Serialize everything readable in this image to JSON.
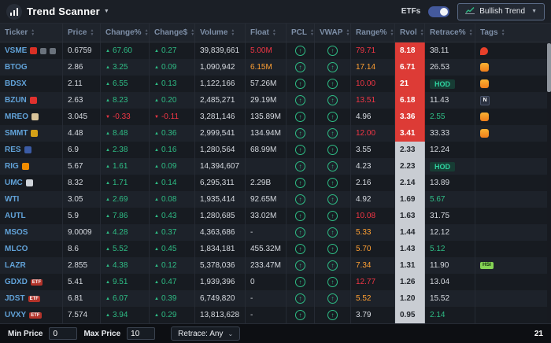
{
  "header": {
    "title": "Trend Scanner",
    "etfs_label": "ETFs",
    "etfs_toggle_on": true,
    "trend_label": "Bullish Trend"
  },
  "table": {
    "etf_badge_label": "ETF",
    "columns": [
      {
        "key": "ticker",
        "label": "Ticker"
      },
      {
        "key": "price",
        "label": "Price"
      },
      {
        "key": "chg_pct",
        "label": "Change%"
      },
      {
        "key": "chg_usd",
        "label": "Change$"
      },
      {
        "key": "volume",
        "label": "Volume"
      },
      {
        "key": "float",
        "label": "Float"
      },
      {
        "key": "pcl",
        "label": "PCL"
      },
      {
        "key": "vwap",
        "label": "VWAP"
      },
      {
        "key": "range",
        "label": "Range%"
      },
      {
        "key": "rvol",
        "label": "Rvol"
      },
      {
        "key": "retrace",
        "label": "Retrace%"
      },
      {
        "key": "tags",
        "label": "Tags"
      }
    ],
    "rows": [
      {
        "ticker": "VSME",
        "logo": "#d93025",
        "ticker_icons": [
          "megaphone-icon",
          "speaker-icon"
        ],
        "price": "0.6759",
        "chg_pct": "67.60",
        "chg_usd": "0.27",
        "dir": "up",
        "volume": "39,839,661",
        "float": "5.00M",
        "float_c": "red",
        "pcl": true,
        "vwap": true,
        "range": "79.71",
        "range_c": "red",
        "rvol": "8.18",
        "rvol_hot": true,
        "retrace": "38.11",
        "retrace_c": "",
        "tags": [
          {
            "kind": "twitter"
          }
        ]
      },
      {
        "ticker": "BTOG",
        "price": "2.86",
        "chg_pct": "3.25",
        "chg_usd": "0.09",
        "dir": "up",
        "volume": "1,090,942",
        "float": "6.15M",
        "float_c": "orange",
        "pcl": true,
        "vwap": true,
        "range": "17.14",
        "range_c": "orange",
        "rvol": "6.71",
        "rvol_hot": true,
        "retrace": "26.53",
        "retrace_c": "",
        "tags": [
          {
            "kind": "fire"
          }
        ]
      },
      {
        "ticker": "BDSX",
        "price": "2.11",
        "chg_pct": "6.55",
        "chg_usd": "0.13",
        "dir": "up",
        "volume": "1,122,166",
        "float": "57.26M",
        "float_c": "",
        "pcl": true,
        "vwap": true,
        "range": "10.00",
        "range_c": "red",
        "rvol": "21",
        "rvol_hot": true,
        "retrace": "HOD",
        "retrace_badge": true,
        "tags": [
          {
            "kind": "fire"
          }
        ]
      },
      {
        "ticker": "BZUN",
        "logo": "#e0312e",
        "price": "2.63",
        "chg_pct": "8.23",
        "chg_usd": "0.20",
        "dir": "up",
        "volume": "2,485,271",
        "float": "29.19M",
        "float_c": "",
        "pcl": true,
        "vwap": true,
        "range": "13.51",
        "range_c": "red",
        "rvol": "6.18",
        "rvol_hot": true,
        "retrace": "11.43",
        "retrace_c": "",
        "tags": [
          {
            "kind": "news",
            "label": "N"
          }
        ]
      },
      {
        "ticker": "MREO",
        "logo": "#d9c49a",
        "price": "3.045",
        "chg_pct": "-0.33",
        "chg_usd": "-0.11",
        "dir": "down",
        "volume": "3,281,146",
        "float": "135.89M",
        "float_c": "",
        "pcl": true,
        "vwap": true,
        "range": "4.96",
        "range_c": "",
        "rvol": "3.36",
        "rvol_hot": true,
        "retrace": "2.55",
        "retrace_c": "green",
        "tags": [
          {
            "kind": "fire"
          }
        ]
      },
      {
        "ticker": "SMMT",
        "logo": "#d4a017",
        "price": "4.48",
        "chg_pct": "8.48",
        "chg_usd": "0.36",
        "dir": "up",
        "volume": "2,999,541",
        "float": "134.94M",
        "float_c": "",
        "pcl": true,
        "vwap": true,
        "range": "12.00",
        "range_c": "red",
        "rvol": "3.41",
        "rvol_hot": true,
        "retrace": "33.33",
        "retrace_c": "",
        "tags": [
          {
            "kind": "fire"
          }
        ]
      },
      {
        "ticker": "RES",
        "logo": "#3b5ba5",
        "price": "6.9",
        "chg_pct": "2.38",
        "chg_usd": "0.16",
        "dir": "up",
        "volume": "1,280,564",
        "float": "68.99M",
        "float_c": "",
        "pcl": true,
        "vwap": true,
        "range": "3.55",
        "range_c": "",
        "rvol": "2.33",
        "rvol_hot": false,
        "retrace": "12.24",
        "retrace_c": "",
        "tags": []
      },
      {
        "ticker": "RIG",
        "logo": "#f08c00",
        "price": "5.67",
        "chg_pct": "1.61",
        "chg_usd": "0.09",
        "dir": "up",
        "volume": "14,394,607",
        "float": "",
        "float_c": "",
        "pcl": true,
        "vwap": true,
        "range": "4.23",
        "range_c": "",
        "rvol": "2.23",
        "rvol_hot": false,
        "retrace": "HOD",
        "retrace_badge": true,
        "tags": []
      },
      {
        "ticker": "UMC",
        "logo": "#cfd4da",
        "price": "8.32",
        "chg_pct": "1.71",
        "chg_usd": "0.14",
        "dir": "up",
        "volume": "6,295,311",
        "float": "2.29B",
        "float_c": "",
        "pcl": true,
        "vwap": true,
        "range": "2.16",
        "range_c": "",
        "rvol": "2.14",
        "rvol_hot": false,
        "retrace": "13.89",
        "retrace_c": "",
        "tags": []
      },
      {
        "ticker": "WTI",
        "price": "3.05",
        "chg_pct": "2.69",
        "chg_usd": "0.08",
        "dir": "up",
        "volume": "1,935,414",
        "float": "92.65M",
        "float_c": "",
        "pcl": true,
        "vwap": true,
        "range": "4.92",
        "range_c": "",
        "rvol": "1.69",
        "rvol_hot": false,
        "retrace": "5.67",
        "retrace_c": "green",
        "tags": []
      },
      {
        "ticker": "AUTL",
        "price": "5.9",
        "chg_pct": "7.86",
        "chg_usd": "0.43",
        "dir": "up",
        "volume": "1,280,685",
        "float": "33.02M",
        "float_c": "",
        "pcl": true,
        "vwap": true,
        "range": "10.08",
        "range_c": "red",
        "rvol": "1.63",
        "rvol_hot": false,
        "retrace": "31.75",
        "retrace_c": "",
        "tags": []
      },
      {
        "ticker": "MSOS",
        "price": "9.0009",
        "chg_pct": "4.28",
        "chg_usd": "0.37",
        "dir": "up",
        "volume": "4,363,686",
        "float": "-",
        "float_c": "",
        "pcl": true,
        "vwap": true,
        "range": "5.33",
        "range_c": "orange",
        "rvol": "1.44",
        "rvol_hot": false,
        "retrace": "12.12",
        "retrace_c": "",
        "tags": []
      },
      {
        "ticker": "MLCO",
        "price": "8.6",
        "chg_pct": "5.52",
        "chg_usd": "0.45",
        "dir": "up",
        "volume": "1,834,181",
        "float": "455.32M",
        "float_c": "",
        "pcl": true,
        "vwap": true,
        "range": "5.70",
        "range_c": "orange",
        "rvol": "1.43",
        "rvol_hot": false,
        "retrace": "5.12",
        "retrace_c": "green",
        "tags": []
      },
      {
        "ticker": "LAZR",
        "price": "2.855",
        "chg_pct": "4.38",
        "chg_usd": "0.12",
        "dir": "up",
        "volume": "5,378,036",
        "float": "233.47M",
        "float_c": "",
        "pcl": true,
        "vwap": true,
        "range": "7.34",
        "range_c": "orange",
        "rvol": "1.31",
        "rvol_hot": false,
        "retrace": "11.90",
        "retrace_c": "",
        "tags": [
          {
            "kind": "hsi",
            "label": "HSI"
          }
        ]
      },
      {
        "ticker": "GDXD",
        "etf": true,
        "price": "5.41",
        "chg_pct": "9.51",
        "chg_usd": "0.47",
        "dir": "up",
        "volume": "1,939,396",
        "float": "0",
        "float_c": "",
        "pcl": true,
        "vwap": true,
        "range": "12.77",
        "range_c": "red",
        "rvol": "1.26",
        "rvol_hot": false,
        "retrace": "13.04",
        "retrace_c": "",
        "tags": []
      },
      {
        "ticker": "JDST",
        "etf": true,
        "price": "6.81",
        "chg_pct": "6.07",
        "chg_usd": "0.39",
        "dir": "up",
        "volume": "6,749,820",
        "float": "-",
        "float_c": "",
        "pcl": true,
        "vwap": true,
        "range": "5.52",
        "range_c": "orange",
        "rvol": "1.20",
        "rvol_hot": false,
        "retrace": "15.52",
        "retrace_c": "",
        "tags": []
      },
      {
        "ticker": "UVXY",
        "etf": true,
        "price": "7.574",
        "chg_pct": "3.94",
        "chg_usd": "0.29",
        "dir": "up",
        "volume": "13,813,628",
        "float": "-",
        "float_c": "",
        "pcl": true,
        "vwap": true,
        "range": "3.79",
        "range_c": "",
        "rvol": "0.95",
        "rvol_hot": false,
        "retrace": "2.14",
        "retrace_c": "green",
        "tags": []
      }
    ]
  },
  "footer": {
    "min_price_label": "Min Price",
    "min_price_value": "0",
    "max_price_label": "Max Price",
    "max_price_value": "10",
    "retrace_filter_label": "Retrace: Any",
    "row_count": "21"
  },
  "colors": {
    "up_green": "#2ebd85",
    "down_red": "#f23645",
    "warn_orange": "#ffa033",
    "hot_badge_red": "#dd3b36",
    "rvol_column_bg": "#c9cdd3",
    "ticker_blue": "#61a2d8",
    "hod_badge_green": "#2fd3a0",
    "fire_tag_orange": "#ef7d1a"
  }
}
